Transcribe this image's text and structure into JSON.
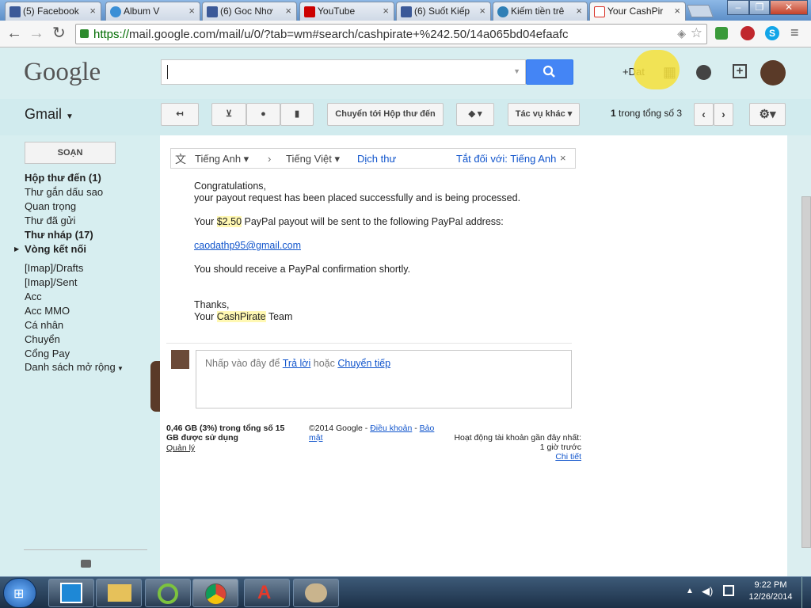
{
  "browser": {
    "tabs": [
      {
        "label": "(5) Facebook",
        "icon": "facebook-icon",
        "color": "#3b5998"
      },
      {
        "label": "Album V",
        "icon": "album-icon",
        "color": "#3a8fd6"
      },
      {
        "label": "(6) Goc Nhơ",
        "icon": "facebook-icon",
        "color": "#3b5998"
      },
      {
        "label": "YouTube",
        "icon": "youtube-icon",
        "color": "#cc0000"
      },
      {
        "label": "(6) Suốt Kiếp",
        "icon": "facebook-icon",
        "color": "#3b5998"
      },
      {
        "label": "Kiếm tiền trê",
        "icon": "site-icon",
        "color": "#2f7fb6"
      },
      {
        "label": "Your CashPir",
        "icon": "gmail-icon",
        "color": "#d93025"
      }
    ],
    "url_secure": "https://",
    "url_rest": "mail.google.com/mail/u/0/?tab=wm#search/cashpirate+%242.50/14a065bd04efaafc"
  },
  "gmail": {
    "logo": "Google",
    "app_label": "Gmail",
    "user_label": "+Dat",
    "compose_label": "SOẠN",
    "toolbar": {
      "move_to_inbox": "Chuyển tới Hộp thư đến",
      "more_actions": "Tác vụ khác",
      "page_count_bold": "1",
      "page_count_rest": "trong tổng số 3"
    },
    "nav": [
      {
        "label": "Hộp thư đến (1)",
        "bold": true
      },
      {
        "label": "Thư gắn dấu sao",
        "bold": false
      },
      {
        "label": "Quan trọng",
        "bold": false
      },
      {
        "label": "Thư đã gửi",
        "bold": false
      },
      {
        "label": "Thư nháp (17)",
        "bold": true
      },
      {
        "label": "Vòng kết nối",
        "bold": true
      },
      {
        "label": "[Imap]/Drafts",
        "bold": false
      },
      {
        "label": "[Imap]/Sent",
        "bold": false
      },
      {
        "label": "Acc",
        "bold": false
      },
      {
        "label": "Acc MMO",
        "bold": false
      },
      {
        "label": "Cá nhân",
        "bold": false
      },
      {
        "label": "Chuyển",
        "bold": false
      },
      {
        "label": "Cổng Pay",
        "bold": false
      },
      {
        "label": "Danh sách mở rộng",
        "bold": false
      }
    ],
    "translate": {
      "from": "Tiếng Anh",
      "to": "Tiếng Việt",
      "action": "Dịch thư",
      "off_for": "Tắt đối với: Tiếng Anh"
    },
    "email": {
      "line1": "Congratulations,",
      "line2": "your payout request has been placed successfully and is being processed.",
      "line3_pre": "Your ",
      "line3_amount": "$2.50",
      "line3_post": " PayPal payout will be sent to the following PayPal address:",
      "email_address": "caodathp95@gmail.com",
      "line4": "You should receive a PayPal confirmation shortly.",
      "thanks": "Thanks,",
      "sign_pre": "Your ",
      "sign_brand": "CashPirate",
      "sign_post": " Team"
    },
    "reply": {
      "prefix": "Nhấp vào đây để ",
      "reply_link": "Trả lời",
      "or": " hoặc ",
      "forward_link": "Chuyển tiếp"
    },
    "footer": {
      "storage": "0,46 GB (3%) trong tổng số 15 GB được sử dụng",
      "manage": "Quản lý",
      "copyright": "©2014 Google - ",
      "terms": "Điều khoản",
      "dash": " - ",
      "privacy": "Bảo mật",
      "activity": "Hoạt động tài khoản gần đây nhất:",
      "activity_time": "1 giờ trước",
      "details": "Chi tiết"
    }
  },
  "taskbar": {
    "time": "9:22 PM",
    "date": "12/26/2014"
  }
}
